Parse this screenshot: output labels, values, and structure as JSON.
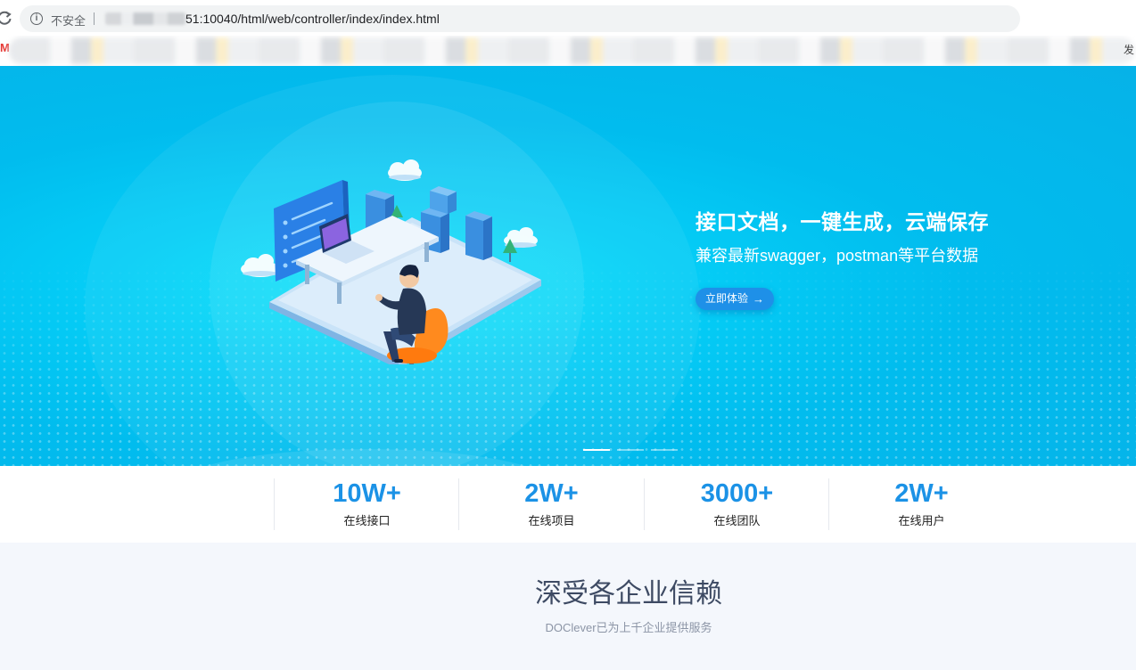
{
  "browser": {
    "security_label": "不安全",
    "url_visible": "51:10040/html/web/controller/index/index.html",
    "bookmark_trailing": "发"
  },
  "hero": {
    "title": "接口文档，一键生成，云端保存",
    "subtitle": "兼容最新swagger，postman等平台数据",
    "cta_label": "立即体验",
    "cta_icon": "arrow-right-icon",
    "slide_count": 3,
    "active_slide": 1
  },
  "stats": [
    {
      "number": "10W+",
      "label": "在线接口"
    },
    {
      "number": "2W+",
      "label": "在线项目"
    },
    {
      "number": "3000+",
      "label": "在线团队"
    },
    {
      "number": "2W+",
      "label": "在线用户"
    }
  ],
  "trust": {
    "title": "深受各企业信赖",
    "subtitle": "DOClever已为上千企业提供服务"
  },
  "colors": {
    "hero_bg": "#01bcee",
    "accent": "#1b92e6",
    "cta_bg": "#1e90e8",
    "trust_bg": "#f4f7fc"
  }
}
